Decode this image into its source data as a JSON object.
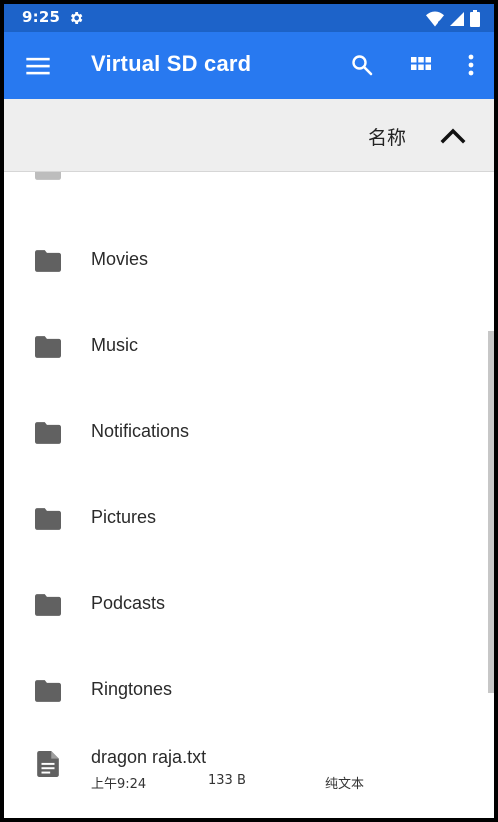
{
  "status": {
    "time": "9:25",
    "icons": [
      "gear-icon",
      "wifi-icon",
      "signal-icon",
      "battery-icon"
    ]
  },
  "appbar": {
    "title": "Virtual SD card",
    "icons": [
      "menu-icon",
      "search-icon",
      "grid-view-icon",
      "more-vert-icon"
    ],
    "color": "#2879f0"
  },
  "sort": {
    "label": "名称",
    "icon": "chevron-up-icon"
  },
  "folders": [
    {
      "name": "Movies"
    },
    {
      "name": "Music"
    },
    {
      "name": "Notifications"
    },
    {
      "name": "Pictures"
    },
    {
      "name": "Podcasts"
    },
    {
      "name": "Ringtones"
    }
  ],
  "file": {
    "name": "dragon raja.txt",
    "time": "上午9:24",
    "size": "133 B",
    "type": "纯文本"
  }
}
